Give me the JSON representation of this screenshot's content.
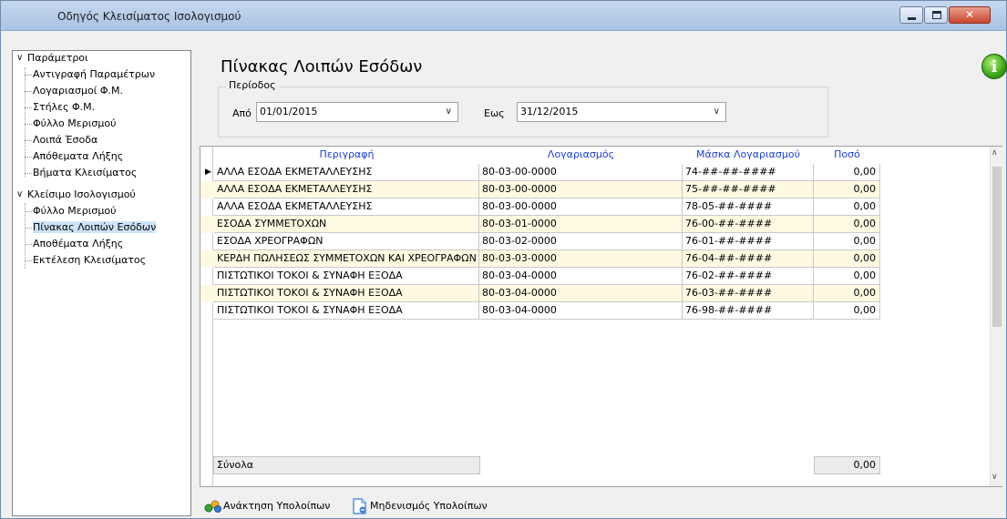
{
  "window": {
    "title": "Οδηγός Κλεισίματος Ισολογισμού"
  },
  "tree": {
    "nodes": [
      {
        "label": "Παράμετροι"
      },
      {
        "label": "Αντιγραφή Παραμέτρων"
      },
      {
        "label": "Λογαριασμοί Φ.Μ."
      },
      {
        "label": "Στήλες Φ.Μ."
      },
      {
        "label": "Φύλλο Μερισμού"
      },
      {
        "label": "Λοιπά Έσοδα"
      },
      {
        "label": "Απόθεματα Λήξης"
      },
      {
        "label": "Βήματα Κλεισίματος"
      },
      {
        "label": "Κλείσιμο Ισολογισμού"
      },
      {
        "label": "Φύλλο Μερισμού"
      },
      {
        "label": "Πίνακας Λοιπών Εσόδων"
      },
      {
        "label": "Αποθέματα Λήξης"
      },
      {
        "label": "Εκτέλεση Κλεισίματος"
      }
    ],
    "selected_index": 10
  },
  "main": {
    "title": "Πίνακας Λοιπών Εσόδων",
    "period": {
      "legend": "Περίοδος",
      "from_label": "Από",
      "from_value": "01/01/2015",
      "to_label": "Εως",
      "to_value": "31/12/2015"
    },
    "grid": {
      "headers": [
        "Περιγραφή",
        "Λογαριασμός",
        "Μάσκα Λογαριασμού",
        "Ποσό"
      ],
      "rows": [
        [
          "ΑΛΛΑ ΕΣΟΔΑ ΕΚΜΕΤΑΛΛΕΥΣΗΣ",
          "80-03-00-0000",
          "74-##-##-####",
          "0,00"
        ],
        [
          "ΑΛΛΑ ΕΣΟΔΑ ΕΚΜΕΤΑΛΛΕΥΣΗΣ",
          "80-03-00-0000",
          "75-##-##-####",
          "0,00"
        ],
        [
          "ΑΛΛΑ ΕΣΟΔΑ ΕΚΜΕΤΑΛΛΕΥΣΗΣ",
          "80-03-00-0000",
          "78-05-##-####",
          "0,00"
        ],
        [
          "ΕΣΟΔΑ ΣΥΜΜΕΤΟΧΩΝ",
          "80-03-01-0000",
          "76-00-##-####",
          "0,00"
        ],
        [
          "ΕΣΟΔΑ ΧΡΕΟΓΡΑΦΩΝ",
          "80-03-02-0000",
          "76-01-##-####",
          "0,00"
        ],
        [
          "ΚΕΡΔΗ ΠΩΛΗΣΕΩΣ ΣΥΜΜΕΤΟΧΩΝ ΚΑΙ ΧΡΕΟΓΡΑΦΩΝ",
          "80-03-03-0000",
          "76-04-##-####",
          "0,00"
        ],
        [
          "ΠΙΣΤΩΤΙΚΟΙ ΤΟΚΟΙ & ΣΥΝΑΦΗ ΕΞΟΔΑ",
          "80-03-04-0000",
          "76-02-##-####",
          "0,00"
        ],
        [
          "ΠΙΣΤΩΤΙΚΟΙ ΤΟΚΟΙ & ΣΥΝΑΦΗ ΕΞΟΔΑ",
          "80-03-04-0000",
          "76-03-##-####",
          "0,00"
        ],
        [
          "ΠΙΣΤΩΤΙΚΟΙ ΤΟΚΟΙ & ΣΥΝΑΦΗ ΕΞΟΔΑ",
          "80-03-04-0000",
          "76-98-##-####",
          "0,00"
        ]
      ],
      "totals_label": "Σύνολα",
      "totals_value": "0,00"
    },
    "buttons": {
      "restore": "Ανάκτηση Υπολοίπων",
      "zero": "Μηδενισμός Υπολοίπων"
    }
  },
  "colors": {
    "header_text": "#1b3fcf",
    "alt_row": "#fefae2",
    "selected_tree": "#cde3f7"
  }
}
